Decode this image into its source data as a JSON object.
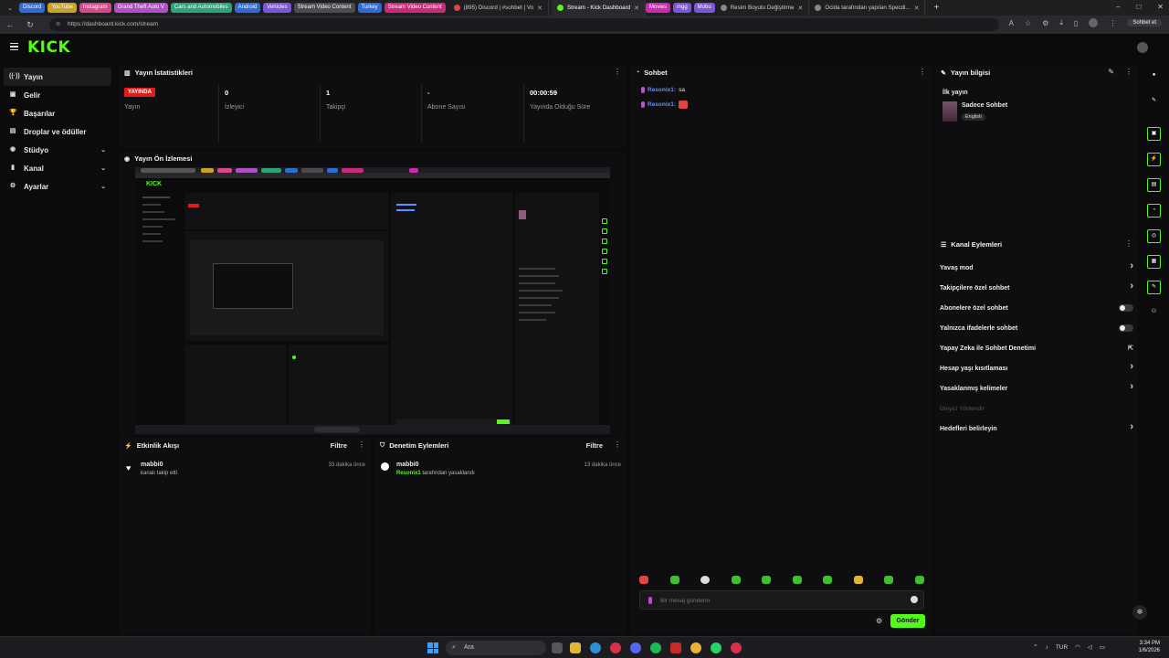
{
  "browser": {
    "group_tabs": [
      {
        "label": "Discord",
        "color": "#2f6bd6"
      },
      {
        "label": "YouTube",
        "color": "#c9a227"
      },
      {
        "label": "Instagram",
        "color": "#d6488a"
      },
      {
        "label": "Grand Theft Auto V",
        "color": "#b04fc4"
      },
      {
        "label": "Cars and Automobiles",
        "color": "#2fa27a"
      },
      {
        "label": "Android",
        "color": "#2f6bd6"
      },
      {
        "label": "Vehicles",
        "color": "#7a57d6"
      },
      {
        "label": "Stream Video Content",
        "color": "#4b4b50"
      },
      {
        "label": "Turkey",
        "color": "#2f6bd6"
      },
      {
        "label": "Stream Video Content",
        "color": "#c92a7a"
      }
    ],
    "discord_tab": "(895) Discord | #sohbet | Vo",
    "tabs": [
      {
        "label": "Stream - Kick Dashboard",
        "active": true
      },
      {
        "label": "Resim Boyutu Değiştirme",
        "active": false
      },
      {
        "label": "Ocida tarafından yapılan Specdi...",
        "active": false
      }
    ],
    "extra_groups": [
      {
        "label": "Movies",
        "color": "#c92ab0"
      },
      {
        "label": "mgg",
        "color": "#7a57d6"
      },
      {
        "label": "Mobu",
        "color": "#7a57d6"
      }
    ],
    "url": "https://dashboard.kick.com/stream",
    "sohbet_label": "Sohbet et"
  },
  "app": {
    "logo": "KICK"
  },
  "sidebar": {
    "items": [
      {
        "label": "Yayın",
        "icon": "broadcast-icon",
        "glyph": "((·))",
        "expand": false
      },
      {
        "label": "Gelir",
        "icon": "revenue-icon",
        "glyph": "▣",
        "expand": false
      },
      {
        "label": "Başarılar",
        "icon": "trophy-icon",
        "glyph": "🏆",
        "expand": false
      },
      {
        "label": "Droplar ve ödüller",
        "icon": "gift-icon",
        "glyph": "▤",
        "expand": false
      },
      {
        "label": "Stüdyo",
        "icon": "studio-icon",
        "glyph": "◉",
        "expand": true
      },
      {
        "label": "Kanal",
        "icon": "channel-icon",
        "glyph": "▮",
        "expand": true
      },
      {
        "label": "Ayarlar",
        "icon": "gear-icon",
        "glyph": "⚙",
        "expand": true
      }
    ]
  },
  "stats": {
    "title": "Yayın İstatistikleri",
    "live_badge": "YAYINDA",
    "items": [
      {
        "value": "",
        "label": "Yayın"
      },
      {
        "value": "0",
        "label": "İzleyici"
      },
      {
        "value": "1",
        "label": "Takipçi"
      },
      {
        "value": "-",
        "label": "Abone Sayısı"
      },
      {
        "value": "00:00:59",
        "label": "Yayında Olduğu Süre"
      }
    ]
  },
  "preview": {
    "title": "Yayın Ön İzlemesi"
  },
  "activity": {
    "title": "Etkinlik Akışı",
    "filter": "Filtre",
    "items": [
      {
        "user": "mabbi0",
        "text": "kanalı takip etti",
        "time": "33 dakika önce"
      }
    ]
  },
  "moderation": {
    "title": "Denetim Eylemleri",
    "filter": "Filtre",
    "items": [
      {
        "user": "mabbi0",
        "actor": "Resonix1",
        "text": "tarafından yasaklandı",
        "time": "13 dakika önce"
      }
    ]
  },
  "chat": {
    "title": "Sohbet",
    "messages": [
      {
        "user": "Resonix1:",
        "text": "sa"
      },
      {
        "user": "Resonix1:",
        "text": ""
      }
    ],
    "input_placeholder": "Bir mesaj gönderin",
    "send_label": "Gönder"
  },
  "stream_info": {
    "title": "Yayın bilgisi",
    "stream_title": "İlk yayın",
    "category": "Sadece Sohbet",
    "language": "English"
  },
  "channel_actions": {
    "title": "Kanal Eylemleri",
    "items": [
      {
        "label": "Yavaş mod",
        "control": "chevron",
        "disabled": false
      },
      {
        "label": "Takipçilere özel sohbet",
        "control": "chevron",
        "disabled": false
      },
      {
        "label": "Abonelere özel sohbet",
        "control": "toggle",
        "disabled": false
      },
      {
        "label": "Yalnızca ifadelerle sohbet",
        "control": "toggle",
        "disabled": false
      },
      {
        "label": "Yapay Zeka ile Sohbet Denetimi",
        "control": "external",
        "disabled": false
      },
      {
        "label": "Hesap yaşı kısıtlaması",
        "control": "chevron",
        "disabled": false
      },
      {
        "label": "Yasaklanmış kelimeler",
        "control": "chevron",
        "disabled": false
      },
      {
        "label": "İzleyici Yönlendir",
        "control": "none",
        "disabled": true
      },
      {
        "label": "Hedefleri belirleyin",
        "control": "chevron",
        "disabled": false
      }
    ]
  },
  "taskbar": {
    "search": "Ara",
    "lang": "TUR",
    "time": "3:34 PM",
    "date": "1/6/2026"
  }
}
